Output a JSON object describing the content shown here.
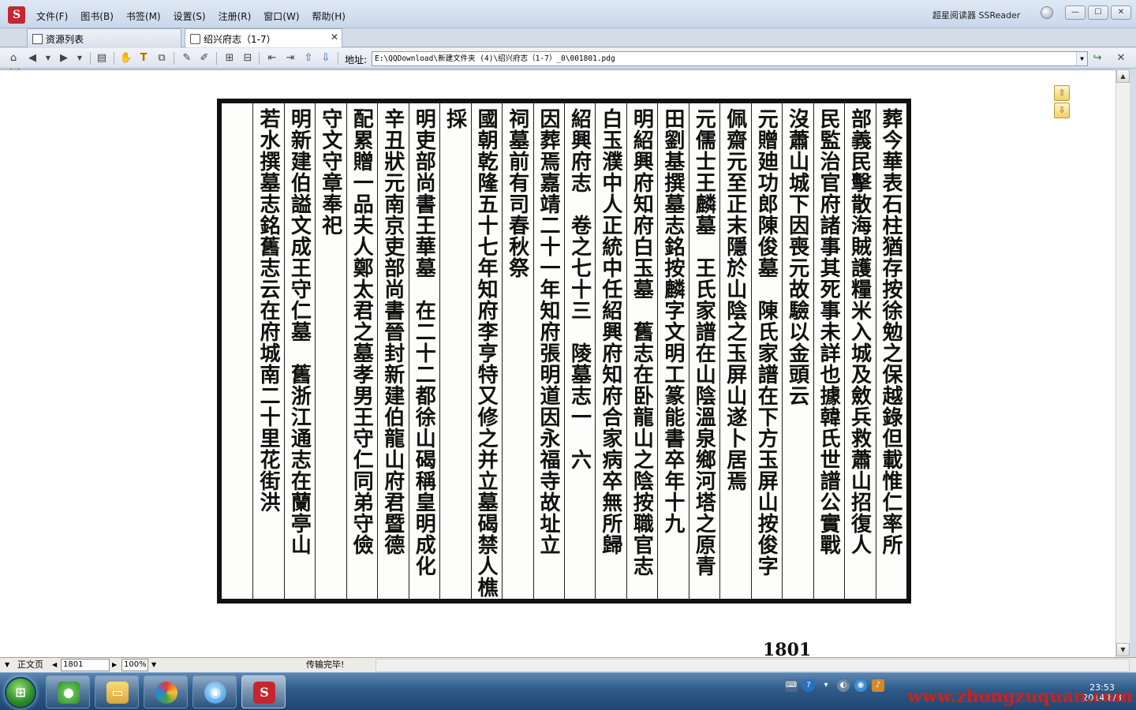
{
  "window": {
    "app_title": "超星阅读器 SSReader",
    "menu": [
      "文件(F)",
      "图书(B)",
      "书签(M)",
      "设置(S)",
      "注册(R)",
      "窗口(W)",
      "帮助(H)"
    ],
    "controls": {
      "minimize": "—",
      "maximize": "☐",
      "close": "✕"
    }
  },
  "tabs": [
    {
      "label": "资源列表",
      "active": false
    },
    {
      "label": "绍兴府志（1-7）",
      "active": true,
      "close": "✕"
    }
  ],
  "toolbar": {
    "address_label": "地址:",
    "address_value": "E:\\QQDownload\\新建文件夹 (4)\\绍兴府志（1-7）_0\\001801.pdg"
  },
  "document": {
    "columns": [
      "葬今華表石柱猶存按徐勉之保越錄但載惟仁率所",
      "部義民擊散海賊護糧米入城及斂兵救蕭山招復人",
      "民監治官府諸事其死事未詳也據韓氏世譜公實戰",
      "沒蕭山城下因喪元故驗以金頭云",
      "元贈廸功郎陳俊墓　陳氏家譜在下方玉屏山按俊字",
      "佩齋元至正末隱於山陰之玉屏山遂卜居焉",
      "元儒士王麟墓　王氏家譜在山陰溫泉鄉河塔之原青",
      "田劉基撰墓志銘按麟字文明工篆能書卒年十九",
      "明紹興府知府白玉墓　舊志在卧龍山之陰按職官志",
      "白玉濮中人正統中任紹興府知府合家病卒無所歸",
      "紹興府志　卷之七十三　陵墓志一　六",
      "因葬焉嘉靖二十一年知府張明道因永福寺故址立",
      "祠墓前有司春秋祭",
      "國朝乾隆五十七年知府李亨特又修之并立墓碣禁人樵",
      "採",
      "明吏部尚書王華墓　在二十二都徐山碣稱皇明成化",
      "辛丑狀元南京吏部尚書晉封新建伯龍山府君暨德",
      "配累贈一品夫人鄭太君之墓孝男王守仁同弟守儉",
      "守文守章奉祀",
      "明新建伯謚文成王守仁墓　舊浙江通志在蘭亭山",
      "若水撰墓志銘舊志云在府城南二十里花街洪",
      ""
    ],
    "page_number": "1801"
  },
  "statusbar": {
    "view_mode": "正文页",
    "page_input": "1801",
    "zoom": "100%",
    "status_text": "传输完毕!"
  },
  "taskbar": {
    "clock_time": "23:53",
    "clock_date": "2014/8/8"
  },
  "watermark": "www.zhongzuquan.com"
}
